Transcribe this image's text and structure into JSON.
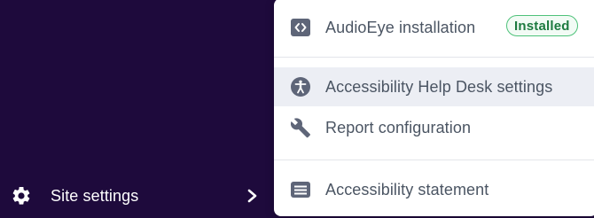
{
  "sidebar": {
    "site_settings_label": "Site settings"
  },
  "menu": {
    "items": [
      {
        "label": "AudioEye installation",
        "icon": "code-brackets-icon",
        "badge": "Installed"
      },
      {
        "label": "Accessibility Help Desk settings",
        "icon": "accessibility-person-icon",
        "hovered": true
      },
      {
        "label": "Report configuration",
        "icon": "wrench-icon"
      },
      {
        "label": "Accessibility statement",
        "icon": "document-lines-icon"
      }
    ]
  },
  "colors": {
    "sidebar_bg": "#1e0a3c",
    "menu_bg": "#ffffff",
    "icon_color": "#5e6578",
    "hover_bg": "#eceef4",
    "badge_border": "#4ec27a",
    "badge_text": "#1c7a3f"
  }
}
